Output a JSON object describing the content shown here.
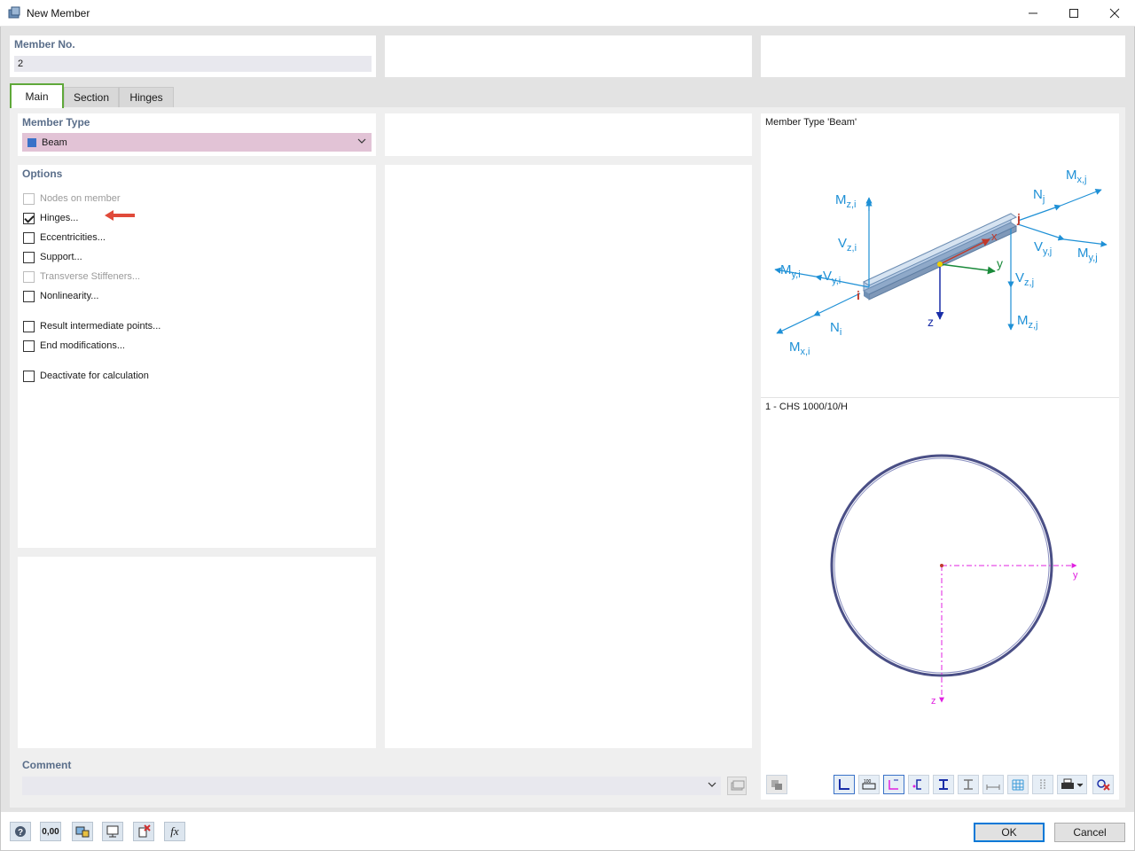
{
  "window": {
    "title": "New Member",
    "minimize": "—",
    "maximize": "☐",
    "close": "✕"
  },
  "member_no": {
    "label": "Member No.",
    "value": "2"
  },
  "tabs": [
    {
      "label": "Main",
      "active": true
    },
    {
      "label": "Section"
    },
    {
      "label": "Hinges"
    }
  ],
  "member_type": {
    "label": "Member Type",
    "value": "Beam",
    "color": "#3a72c8"
  },
  "options": {
    "label": "Options",
    "items": [
      {
        "label": "Nodes on member",
        "checked": false,
        "enabled": false
      },
      {
        "label": "Hinges...",
        "checked": true,
        "enabled": true
      },
      {
        "label": "Eccentricities...",
        "checked": false,
        "enabled": true
      },
      {
        "label": "Support...",
        "checked": false,
        "enabled": true
      },
      {
        "label": "Transverse Stiffeners...",
        "checked": false,
        "enabled": false
      },
      {
        "label": "Nonlinearity...",
        "checked": false,
        "enabled": true
      },
      {
        "label": "Result intermediate points...",
        "checked": false,
        "enabled": true
      },
      {
        "label": "End modifications...",
        "checked": false,
        "enabled": true
      },
      {
        "label": "Deactivate for calculation",
        "checked": false,
        "enabled": true
      }
    ]
  },
  "comment": {
    "label": "Comment",
    "value": ""
  },
  "preview": {
    "beam_caption": "Member Type 'Beam'",
    "section_caption": "1 - CHS 1000/10/H",
    "diagram": {
      "labels": {
        "mzi": "M",
        "mzi_sub": "z,i",
        "vzi": "V",
        "vzi_sub": "z,i",
        "myi": "M",
        "myi_sub": "y,i",
        "vyi": "V",
        "vyi_sub": "y,i",
        "ni": "N",
        "ni_sub": "i",
        "mxi": "M",
        "mxi_sub": "x,i",
        "nj": "N",
        "nj_sub": "j",
        "mxj": "M",
        "mxj_sub": "x,j",
        "vyj": "V",
        "vyj_sub": "y,j",
        "myj": "M",
        "myj_sub": "y,j",
        "vzj": "V",
        "vzj_sub": "z,j",
        "mzj": "M",
        "mzj_sub": "z,j",
        "node_i": "i",
        "node_j": "j",
        "axis_x": "x",
        "axis_y": "y",
        "axis_z": "z"
      },
      "colors": {
        "force": "#1e90d6",
        "node": "#c0392b",
        "y_axis": "#1a8a3a",
        "z_axis": "#1a2ea8",
        "x_axis": "#c0392b"
      }
    },
    "section_axes": {
      "y": "y",
      "z": "z",
      "color": "#e020e0"
    }
  },
  "footer": {
    "icons": [
      "help-icon",
      "units-icon",
      "display-icon",
      "view-icon",
      "delete-icon",
      "function-icon"
    ],
    "units_text": "0,00",
    "fx_text": "fx",
    "ok": "OK",
    "cancel": "Cancel"
  }
}
